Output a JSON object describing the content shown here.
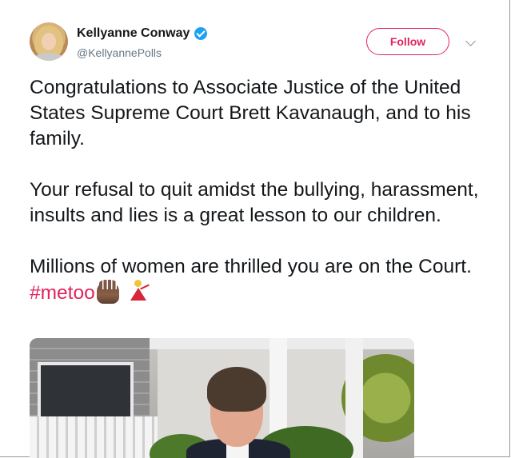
{
  "author": {
    "display_name": "Kellyanne Conway",
    "handle": "@KellyannePolls",
    "verified": true
  },
  "actions": {
    "follow_label": "Follow"
  },
  "tweet": {
    "paragraph_1": "Congratulations to Associate Justice of the United States Supreme Court Brett Kavanaugh, and to his family.",
    "paragraph_2": "Your refusal to quit amidst the bullying, harassment, insults and lies is a great lesson to our children.",
    "paragraph_3_prefix": "Millions of women are thrilled you are on the Court. ",
    "hashtag": "#metoo",
    "emojis": [
      "raised-hand-icon",
      "dancer-icon"
    ]
  },
  "colors": {
    "accent": "#e0245e",
    "verified": "#1da1f2",
    "text": "#14171a",
    "secondary_text": "#657786"
  }
}
